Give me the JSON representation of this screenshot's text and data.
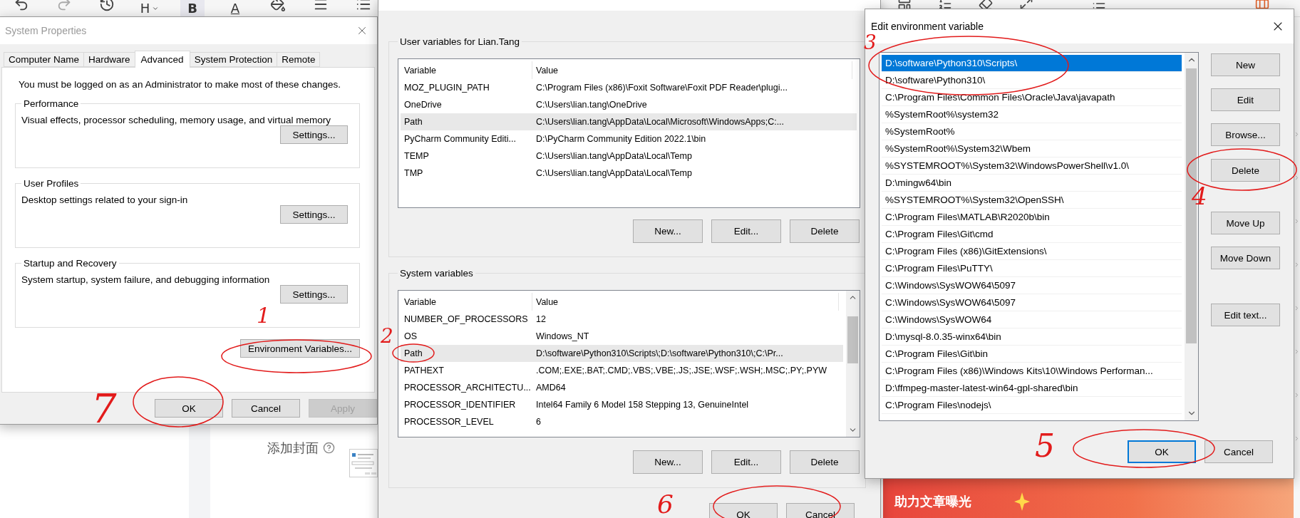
{
  "editor_toolbar": {
    "glyph_buttons": [
      {
        "kind": "heading",
        "label": "H",
        "active": false
      },
      {
        "kind": "bold",
        "label": "B",
        "active": true
      },
      {
        "kind": "color",
        "label": "A",
        "active": false
      }
    ]
  },
  "system_properties": {
    "title": "System Properties",
    "tabs": [
      {
        "label": "Computer Name",
        "selected": false
      },
      {
        "label": "Hardware",
        "selected": false
      },
      {
        "label": "Advanced",
        "selected": true
      },
      {
        "label": "System Protection",
        "selected": false
      },
      {
        "label": "Remote",
        "selected": false
      }
    ],
    "notice": "You must be logged on as an Administrator to make most of these changes.",
    "groups": [
      {
        "title": "Performance",
        "description": "Visual effects, processor scheduling, memory usage, and virtual memory",
        "button": "Settings..."
      },
      {
        "title": "User Profiles",
        "description": "Desktop settings related to your sign-in",
        "button": "Settings..."
      },
      {
        "title": "Startup and Recovery",
        "description": "System startup, system failure, and debugging information",
        "button": "Settings..."
      }
    ],
    "env_button": "Environment Variables...",
    "buttons": [
      {
        "label": "OK",
        "disabled": false
      },
      {
        "label": "Cancel",
        "disabled": false
      },
      {
        "label": "Apply",
        "disabled": true
      }
    ]
  },
  "environment_variables": {
    "user_group": {
      "title": "User variables for Lian.Tang",
      "columns": [
        "Variable",
        "Value"
      ],
      "rows": [
        {
          "variable": "MOZ_PLUGIN_PATH",
          "value": "C:\\Program Files (x86)\\Foxit Software\\Foxit PDF Reader\\plugi...",
          "selected": false
        },
        {
          "variable": "OneDrive",
          "value": "C:\\Users\\lian.tang\\OneDrive",
          "selected": false
        },
        {
          "variable": "Path",
          "value": "C:\\Users\\lian.tang\\AppData\\Local\\Microsoft\\WindowsApps;C:...",
          "selected": true
        },
        {
          "variable": "PyCharm Community Editi...",
          "value": "D:\\PyCharm Community Edition 2022.1\\bin",
          "selected": false
        },
        {
          "variable": "TEMP",
          "value": "C:\\Users\\lian.tang\\AppData\\Local\\Temp",
          "selected": false
        },
        {
          "variable": "TMP",
          "value": "C:\\Users\\lian.tang\\AppData\\Local\\Temp",
          "selected": false
        }
      ],
      "buttons": [
        "New...",
        "Edit...",
        "Delete"
      ]
    },
    "system_group": {
      "title": "System variables",
      "columns": [
        "Variable",
        "Value"
      ],
      "rows": [
        {
          "variable": "NUMBER_OF_PROCESSORS",
          "value": "12",
          "selected": false
        },
        {
          "variable": "OS",
          "value": "Windows_NT",
          "selected": false
        },
        {
          "variable": "Path",
          "value": "D:\\software\\Python310\\Scripts\\;D:\\software\\Python310\\;C:\\Pr...",
          "selected": true
        },
        {
          "variable": "PATHEXT",
          "value": ".COM;.EXE;.BAT;.CMD;.VBS;.VBE;.JS;.JSE;.WSF;.WSH;.MSC;.PY;.PYW",
          "selected": false
        },
        {
          "variable": "PROCESSOR_ARCHITECTU...",
          "value": "AMD64",
          "selected": false
        },
        {
          "variable": "PROCESSOR_IDENTIFIER",
          "value": "Intel64 Family 6 Model 158 Stepping 13, GenuineIntel",
          "selected": false
        },
        {
          "variable": "PROCESSOR_LEVEL",
          "value": "6",
          "selected": false
        }
      ],
      "buttons": [
        "New...",
        "Edit...",
        "Delete"
      ]
    },
    "buttons": [
      "OK",
      "Cancel"
    ]
  },
  "edit_variable": {
    "title": "Edit environment variable",
    "entries": [
      {
        "text": "D:\\software\\Python310\\Scripts\\",
        "selected": true
      },
      {
        "text": "D:\\software\\Python310\\",
        "selected": false
      },
      {
        "text": "C:\\Program Files\\Common Files\\Oracle\\Java\\javapath",
        "selected": false
      },
      {
        "text": "%SystemRoot%\\system32",
        "selected": false
      },
      {
        "text": "%SystemRoot%",
        "selected": false
      },
      {
        "text": "%SystemRoot%\\System32\\Wbem",
        "selected": false
      },
      {
        "text": "%SYSTEMROOT%\\System32\\WindowsPowerShell\\v1.0\\",
        "selected": false
      },
      {
        "text": "D:\\mingw64\\bin",
        "selected": false
      },
      {
        "text": "%SYSTEMROOT%\\System32\\OpenSSH\\",
        "selected": false
      },
      {
        "text": "C:\\Program Files\\MATLAB\\R2020b\\bin",
        "selected": false
      },
      {
        "text": "C:\\Program Files\\Git\\cmd",
        "selected": false
      },
      {
        "text": "C:\\Program Files (x86)\\GitExtensions\\",
        "selected": false
      },
      {
        "text": "C:\\Program Files\\PuTTY\\",
        "selected": false
      },
      {
        "text": "C:\\Windows\\SysWOW64\\5097",
        "selected": false
      },
      {
        "text": "C:\\Windows\\SysWOW64\\5097",
        "selected": false
      },
      {
        "text": "C:\\Windows\\SysWOW64",
        "selected": false
      },
      {
        "text": "D:\\mysql-8.0.35-winx64\\bin",
        "selected": false
      },
      {
        "text": "C:\\Program Files\\Git\\bin",
        "selected": false
      },
      {
        "text": "C:\\Program Files (x86)\\Windows Kits\\10\\Windows Performan...",
        "selected": false
      },
      {
        "text": "D:\\ffmpeg-master-latest-win64-gpl-shared\\bin",
        "selected": false
      },
      {
        "text": "C:\\Program Files\\nodejs\\",
        "selected": false
      }
    ],
    "side_buttons": [
      "New",
      "Edit",
      "Browse...",
      "Delete",
      "Move Up",
      "Move Down",
      "Edit text..."
    ],
    "buttons": [
      {
        "label": "OK",
        "focused": true
      },
      {
        "label": "Cancel",
        "focused": false
      }
    ]
  },
  "editor": {
    "cover_label": "添加封面"
  },
  "banner": {
    "text": "助力文章曝光"
  },
  "annotations": [
    {
      "label": "1"
    },
    {
      "label": "2"
    },
    {
      "label": "3"
    },
    {
      "label": "4"
    },
    {
      "label": "5"
    },
    {
      "label": "6"
    },
    {
      "label": "7"
    }
  ]
}
